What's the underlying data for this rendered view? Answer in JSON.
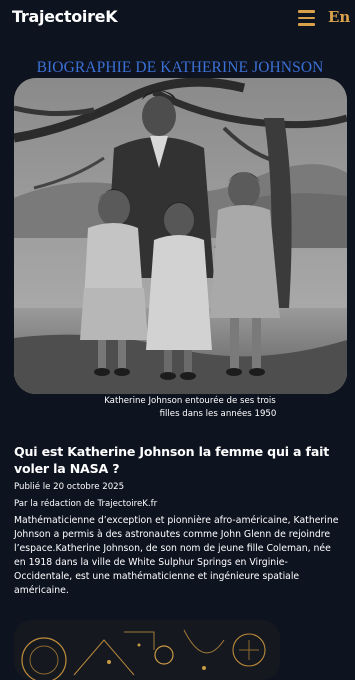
{
  "header": {
    "brand": "TrajectoireK",
    "menu_icon": "hamburger-menu-icon",
    "language": "En",
    "accent_color": "#d9a14a"
  },
  "page": {
    "heading": "BIOGRAPHIE DE KATHERINE JOHNSON",
    "heading_color": "#3b70d6",
    "background_color": "#0e1320"
  },
  "photo": {
    "caption_line1": "Katherine Johnson entourée de ses trois",
    "caption_line2": "filles dans les années 1950"
  },
  "article": {
    "title": "Qui est Katherine Johnson la femme qui a fait voler la NASA ?",
    "published": "Publié le 20 octobre 2025",
    "byline": "Par la rédaction de TrajectoireK.fr",
    "intro": "Mathématicienne d’exception et pionnière afro-américaine, Katherine Johnson a permis à des astronautes comme John Glenn de rejoindre l’espace.Katherine Johnson, de son nom de jeune fille Coleman, née en 1918 dans la ville de White Sulphur Springs en Virginie-Occidentale, est une mathématicienne et ingénieure spatiale américaine."
  }
}
